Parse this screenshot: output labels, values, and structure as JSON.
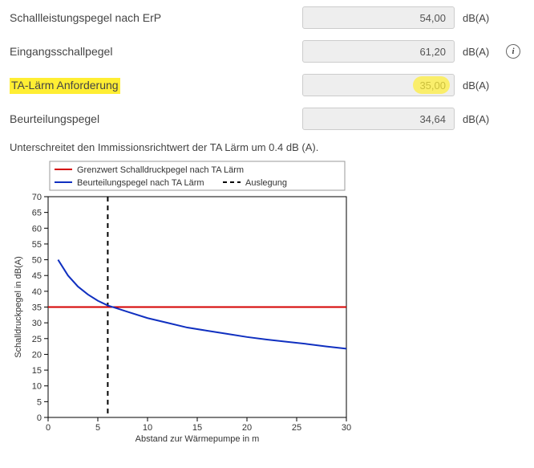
{
  "rows": [
    {
      "label": "Schallleistungspegel nach ErP",
      "value": "54,00",
      "unit": "dB(A)",
      "info": false,
      "highlightLabel": false,
      "highlightValue": false
    },
    {
      "label": "Eingangsschallpegel",
      "value": "61,20",
      "unit": "dB(A)",
      "info": true,
      "highlightLabel": false,
      "highlightValue": false
    },
    {
      "label": "TA-Lärm Anforderung",
      "value": "35,00",
      "unit": "dB(A)",
      "info": false,
      "highlightLabel": true,
      "highlightValue": true
    },
    {
      "label": "Beurteilungspegel",
      "value": "34,64",
      "unit": "dB(A)",
      "info": false,
      "highlightLabel": false,
      "highlightValue": false
    }
  ],
  "note": "Unterschreitet den Immissionsrichtwert der TA Lärm um 0.4 dB (A).",
  "infoGlyph": "i",
  "chart_data": {
    "type": "line",
    "title": "",
    "xlabel": "Abstand zur Wärmepumpe in m",
    "ylabel": "Schalldruckpegel in dB(A)",
    "xlim": [
      0,
      30
    ],
    "ylim": [
      0,
      70
    ],
    "xticks": [
      0,
      5,
      10,
      15,
      20,
      25,
      30
    ],
    "yticks": [
      0,
      5,
      10,
      15,
      20,
      25,
      30,
      35,
      40,
      45,
      50,
      55,
      60,
      65,
      70
    ],
    "legend": [
      {
        "name": "Grenzwert Schalldruckpegel nach TA Lärm",
        "color": "#d40000"
      },
      {
        "name": "Beurteilungspegel nach TA Lärm",
        "color": "#1030c0"
      },
      {
        "name": "Auslegung",
        "dash": true,
        "color": "#000000"
      }
    ],
    "series": [
      {
        "name": "Grenzwert Schalldruckpegel nach TA Lärm",
        "color": "#d40000",
        "x": [
          0,
          30
        ],
        "y": [
          35,
          35
        ]
      },
      {
        "name": "Beurteilungspegel nach TA Lärm",
        "color": "#1030c0",
        "x": [
          1,
          2,
          3,
          4,
          5,
          6,
          7,
          8,
          10,
          12,
          14,
          16,
          18,
          20,
          22,
          24,
          26,
          28,
          30
        ],
        "y": [
          50,
          45,
          41.5,
          39,
          37,
          35.5,
          34.5,
          33.5,
          31.5,
          30,
          28.5,
          27.5,
          26.5,
          25.5,
          24.7,
          24,
          23.3,
          22.5,
          21.8
        ]
      }
    ],
    "auslegung_x": 6
  }
}
